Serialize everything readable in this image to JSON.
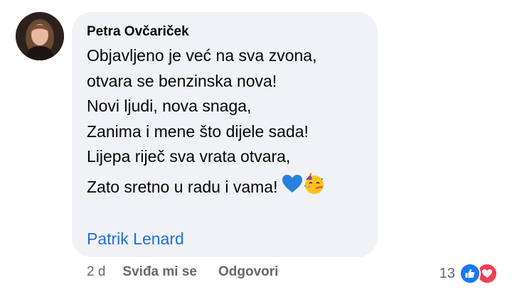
{
  "comment": {
    "author": "Petra Ovčariček",
    "lines": [
      "Objavljeno je već na sva zvona,",
      "otvara se benzinska nova!",
      "Novi ljudi, nova snaga,",
      "Zanima i mene što dijele sada!",
      "Lijepa riječ sva vrata otvara,",
      "Zato sretno u radu i vama!"
    ],
    "emojis": [
      "blue-heart-icon",
      "partying-face-icon"
    ],
    "mention": "Patrik Lenard"
  },
  "actions": {
    "time": "2 d",
    "like_label": "Sviđa mi se",
    "reply_label": "Odgovori"
  },
  "reactions": {
    "count": "13",
    "types": [
      "like-icon",
      "love-icon"
    ]
  },
  "colors": {
    "bubble": "#f0f2f5",
    "mention": "#216fdb",
    "meta": "#65676b",
    "like": "#1877f2",
    "love": "#f33e58"
  }
}
